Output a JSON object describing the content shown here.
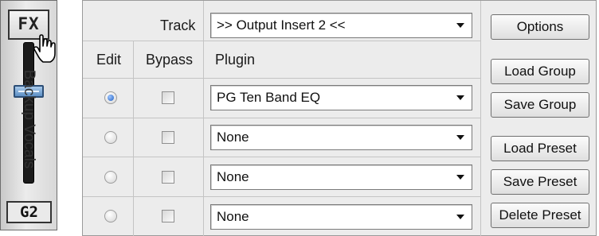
{
  "strip": {
    "fx_label": "FX",
    "name": "Backup Vocals",
    "group": "G2"
  },
  "panel": {
    "track_label": "Track",
    "track_value": ">> Output Insert 2 <<",
    "headers": {
      "edit": "Edit",
      "bypass": "Bypass",
      "plugin": "Plugin"
    },
    "rows": [
      {
        "plugin": "PG Ten Band EQ",
        "edit_selected": true,
        "bypass": false
      },
      {
        "plugin": "None",
        "edit_selected": false,
        "bypass": false
      },
      {
        "plugin": "None",
        "edit_selected": false,
        "bypass": false
      },
      {
        "plugin": "None",
        "edit_selected": false,
        "bypass": false
      }
    ],
    "buttons": {
      "options": "Options",
      "load_group": "Load Group",
      "save_group": "Save Group",
      "load_preset": "Load Preset",
      "save_preset": "Save Preset",
      "delete_preset": "Delete Preset"
    }
  },
  "colors": {
    "selected_radio": "#1e5fc2",
    "fader_knob": "#5d8fc4"
  }
}
